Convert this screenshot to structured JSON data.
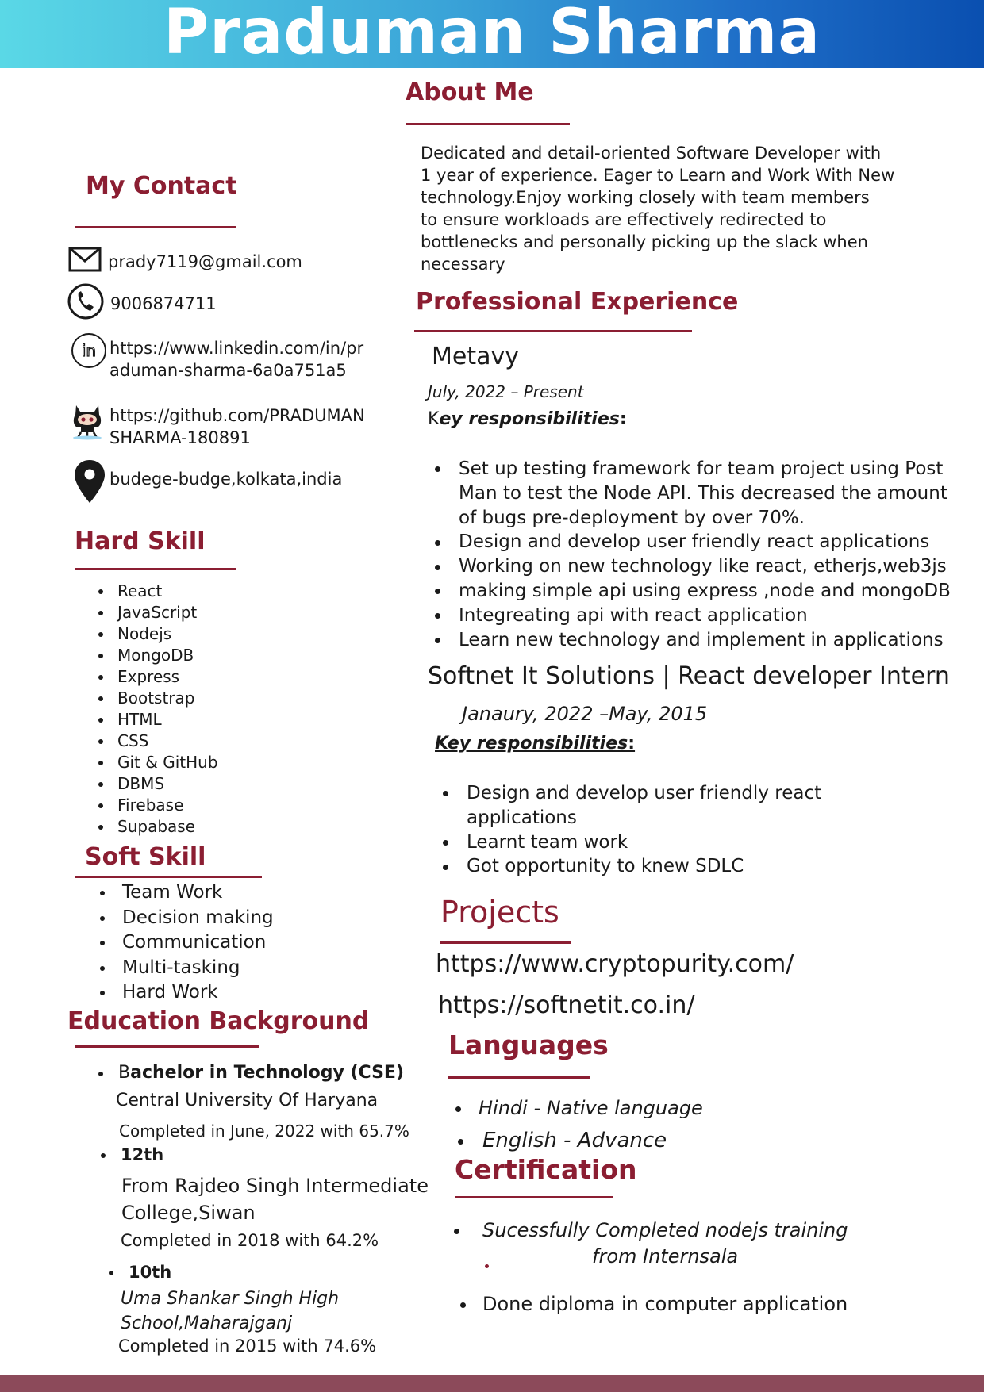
{
  "name": "Praduman Sharma",
  "contact": {
    "heading": "My Contact",
    "email": "prady7119@gmail.com",
    "phone": "9006874711",
    "linkedin_line1": "https://www.linkedin.com/in/pr",
    "linkedin_line2": "aduman-sharma-6a0a751a5",
    "github_line1": "https://github.com/PRADUMAN",
    "github_line2": "SHARMA-180891",
    "location": "budege-budge,kolkata,india"
  },
  "hard_skill": {
    "heading": "Hard Skill",
    "items": [
      "React",
      "JavaScript",
      "Nodejs",
      "MongoDB",
      "Express",
      "Bootstrap",
      "HTML",
      "CSS",
      "Git & GitHub",
      "DBMS",
      "Firebase",
      "Supabase"
    ]
  },
  "soft_skill": {
    "heading": "Soft Skill",
    "items": [
      "Team Work",
      "Decision making",
      "Communication",
      "Multi-tasking",
      "Hard Work"
    ]
  },
  "education": {
    "heading": "Education Background",
    "btech_title_b": "B",
    "btech_title_rest": "achelor  in Technology (CSE)",
    "btech_school": "Central University Of Haryana",
    "btech_completed": "Completed in June, 2022 with 65.7%",
    "twelfth_title": "12th",
    "twelfth_school_line1": "From Rajdeo Singh Intermediate",
    "twelfth_school_line2": "College,Siwan",
    "twelfth_completed": "Completed in 2018  with 64.2%",
    "tenth_title": "10th",
    "tenth_school_line1": "Uma Shankar Singh High",
    "tenth_school_line2": "School,Maharajganj",
    "tenth_completed": "Completed in 2015  with 74.6%"
  },
  "about": {
    "heading": "About Me",
    "lines": [
      "Dedicated and detail-oriented Software Developer with",
      "1 year of experience. Eager to Learn and Work With New",
      "technology.Enjoy working closely with team members",
      "to ensure workloads are effectively redirected to",
      "bottlenecks and personally picking up the slack when",
      "necessary"
    ]
  },
  "experience": {
    "heading": "Professional Experience",
    "job1_company": "Metavy",
    "job1_dates": "July, 2022 – Present",
    "job1_kr_k": "K",
    "job1_kr_rest": "ey responsibilities",
    "job1_kr_colon": ":",
    "job1_items": [
      "Set up testing framework for team project using Post",
      "Man to test the Node API. This decreased the amount",
      "of bugs pre-deployment by over 70%.",
      "Design and develop user friendly react applications",
      "Working on new technology like react, etherjs,web3js",
      " making simple api using express ,node and mongoDB",
      "Integreating api with react application",
      "Learn new technology and implement in applications"
    ],
    "job2_company": "Softnet It Solutions | React developer Intern",
    "job2_dates": "Janaury, 2022 –May, 2015",
    "job2_kr": "Key responsibilities",
    "job2_kr_colon": ":",
    "job2_items": [
      "Design and develop user friendly react",
      "applications",
      "Learnt team work",
      "Got opportunity to knew SDLC"
    ]
  },
  "projects": {
    "heading": "Projects",
    "links": [
      "https://www.cryptopurity.com/",
      "https://softnetit.co.in/"
    ]
  },
  "languages": {
    "heading": "Languages",
    "items": [
      "Hindi  - Native language",
      "English  - Advance"
    ]
  },
  "certification": {
    "heading": "Certification",
    "item1_line1": "Sucessfully Completed nodejs training",
    "item1_line2": "from Internsala",
    "item2": "Done diploma in computer application"
  }
}
